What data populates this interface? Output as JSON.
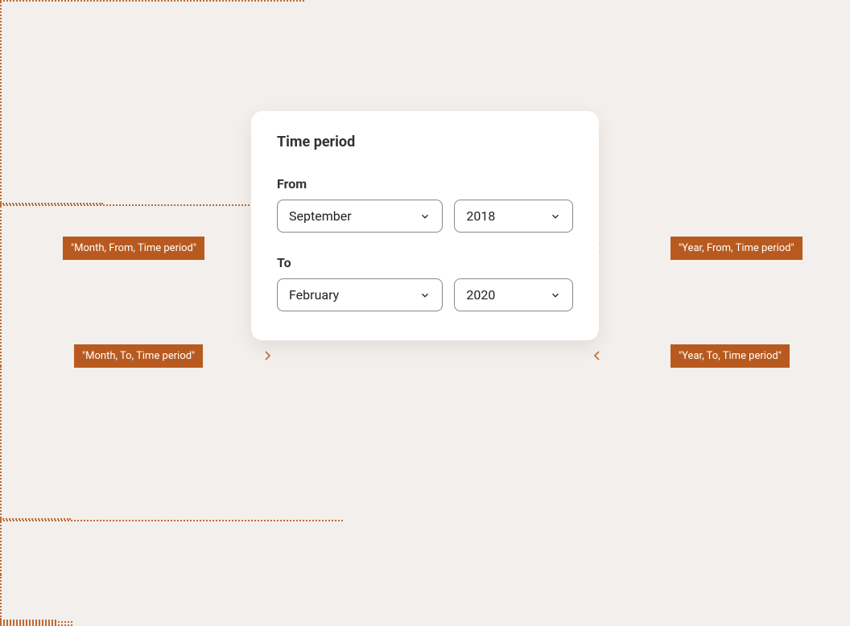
{
  "card": {
    "title": "Time period",
    "from": {
      "label": "From",
      "month": "September",
      "year": "2018"
    },
    "to": {
      "label": "To",
      "month": "February",
      "year": "2020"
    }
  },
  "annotations": {
    "monthFrom": "\"Month, From, Time period\"",
    "yearFrom": "\"Year, From, Time period\"",
    "monthTo": "\"Month, To, Time period\"",
    "yearTo": "\"Year, To, Time period\""
  }
}
